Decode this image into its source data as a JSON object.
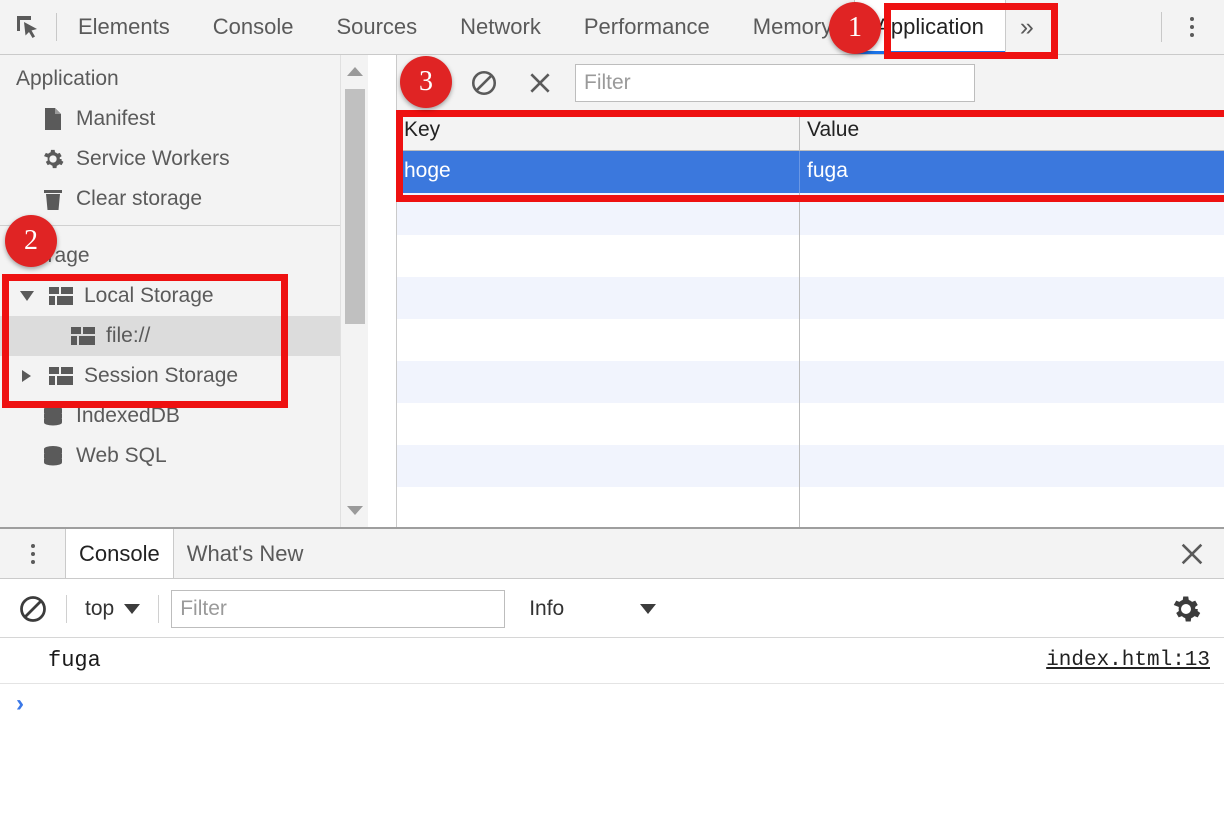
{
  "toolbar": {
    "inspect_icon": "inspect-element-icon",
    "tabs": [
      {
        "label": "Elements",
        "active": false
      },
      {
        "label": "Console",
        "active": false
      },
      {
        "label": "Sources",
        "active": false
      },
      {
        "label": "Network",
        "active": false
      },
      {
        "label": "Performance",
        "active": false
      },
      {
        "label": "Memory",
        "active": false
      },
      {
        "label": "Application",
        "active": true
      }
    ],
    "more_tabs_label": "»",
    "menu_icon": "kebab-menu-icon"
  },
  "sidebar": {
    "application": {
      "title": "Application",
      "items": [
        {
          "label": "Manifest",
          "icon": "document-icon"
        },
        {
          "label": "Service Workers",
          "icon": "gear-icon"
        },
        {
          "label": "Clear storage",
          "icon": "trash-icon"
        }
      ]
    },
    "storage": {
      "title": "Storage",
      "items": [
        {
          "label": "Local Storage",
          "icon": "table-icon",
          "twisty": "expanded",
          "selected": false,
          "indent": 1
        },
        {
          "label": "file://",
          "icon": "table-icon",
          "twisty": "none",
          "selected": true,
          "indent": 2
        },
        {
          "label": "Session Storage",
          "icon": "table-icon",
          "twisty": "collapsed",
          "selected": false,
          "indent": 1
        },
        {
          "label": "IndexedDB",
          "icon": "database-icon",
          "twisty": "none",
          "selected": false,
          "indent": 1
        },
        {
          "label": "Web SQL",
          "icon": "database-icon",
          "twisty": "none",
          "selected": false,
          "indent": 1
        }
      ]
    },
    "scrollbar": {
      "up_arrow": "scroll-up-arrow-icon",
      "down_arrow": "scroll-down-arrow-icon"
    }
  },
  "main": {
    "toolbar": {
      "refresh_icon": "refresh-icon",
      "clear_icon": "no-entry-clear-icon",
      "delete_icon": "x-delete-icon",
      "filter_placeholder": "Filter",
      "filter_value": ""
    },
    "table": {
      "columns": [
        "Key",
        "Value"
      ],
      "rows": [
        {
          "key": "hoge",
          "value": "fuga",
          "selected": true
        }
      ],
      "empty_row_count": 8
    }
  },
  "drawer": {
    "menu_icon": "kebab-menu-icon",
    "tabs": [
      {
        "label": "Console",
        "active": true
      },
      {
        "label": "What's New",
        "active": false
      }
    ],
    "close_icon": "close-icon"
  },
  "console": {
    "toolbar": {
      "clear_icon": "no-entry-clear-icon",
      "context": "top",
      "context_caret": "chevron-down-icon",
      "filter_placeholder": "Filter",
      "filter_value": "",
      "level": "Info",
      "level_caret": "chevron-down-icon",
      "settings_icon": "gear-icon"
    },
    "messages": [
      {
        "text": "fuga",
        "source": "index.html:13"
      }
    ],
    "prompt": "›"
  },
  "annotations": {
    "badges": [
      {
        "number": "1",
        "target": "application-tab"
      },
      {
        "number": "2",
        "target": "storage-section"
      },
      {
        "number": "3",
        "target": "refresh-button"
      }
    ],
    "highlight_color": "#ee1111",
    "badge_color": "#e02424"
  }
}
